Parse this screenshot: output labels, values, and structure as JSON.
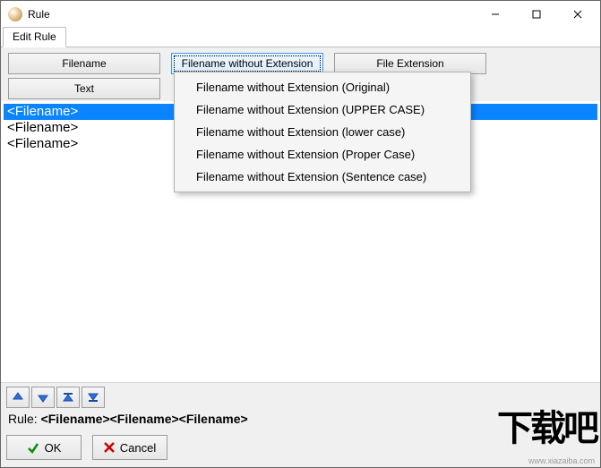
{
  "window": {
    "title": "Rule"
  },
  "tabs": {
    "edit": "Edit Rule"
  },
  "buttons": {
    "filename": "Filename",
    "filename_noext": "Filename without Extension",
    "file_ext": "File Extension",
    "text": "Text"
  },
  "dropdown": {
    "items": [
      "Filename without Extension (Original)",
      "Filename without Extension (UPPER CASE)",
      "Filename without Extension (lower case)",
      "Filename without Extension (Proper Case)",
      "Filename without Extension (Sentence case)"
    ]
  },
  "list": {
    "items": [
      "<Filename>",
      "<Filename>",
      "<Filename>"
    ]
  },
  "rule": {
    "label": "Rule:",
    "value": "<Filename><Filename><Filename>"
  },
  "dialog": {
    "ok": "OK",
    "cancel": "Cancel"
  },
  "watermark": {
    "big": "下载吧",
    "url": "www.xiazaiba.com"
  }
}
